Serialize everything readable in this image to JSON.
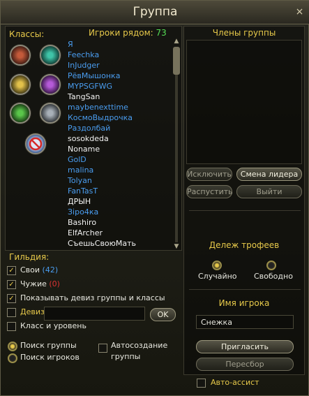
{
  "window": {
    "title": "Группа",
    "close": "×"
  },
  "classes": {
    "label": "Классы:"
  },
  "nearby": {
    "label": "Игроки рядом:",
    "count": "73"
  },
  "players": [
    {
      "name": "Я",
      "color": "#4a9df0"
    },
    {
      "name": "Feechka",
      "color": "#4a9df0"
    },
    {
      "name": "InJudger",
      "color": "#4a9df0"
    },
    {
      "name": "РёвМышонка",
      "color": "#4a9df0"
    },
    {
      "name": "MYPSGFWG",
      "color": "#4a9df0"
    },
    {
      "name": "TangSan",
      "color": "#f2f2f2"
    },
    {
      "name": "maybenexttime",
      "color": "#4a9df0"
    },
    {
      "name": "КосмоВыдрочка",
      "color": "#4a9df0"
    },
    {
      "name": "Раздолбай",
      "color": "#4a9df0"
    },
    {
      "name": "sosokdeda",
      "color": "#f2f2f2"
    },
    {
      "name": "Noname",
      "color": "#f2f2f2"
    },
    {
      "name": "GolD",
      "color": "#4a9df0"
    },
    {
      "name": "malina",
      "color": "#4a9df0"
    },
    {
      "name": "Tolyan",
      "color": "#4a9df0"
    },
    {
      "name": "FanTasT",
      "color": "#4a9df0"
    },
    {
      "name": "ДРЫН",
      "color": "#f2f2f2"
    },
    {
      "name": "Зіро4ка",
      "color": "#4a9df0"
    },
    {
      "name": "Bashiro",
      "color": "#f2f2f2"
    },
    {
      "name": "ElfArcher",
      "color": "#f2f2f2"
    },
    {
      "name": "СъешьСвоюМать",
      "color": "#f2f2f2"
    }
  ],
  "guild": {
    "label": "Гильдия:",
    "own_label": "Свои",
    "own_count": "(42)",
    "foreign_label": "Чужие",
    "foreign_count": "(0)",
    "show_motto": "Показывать девиз группы и классы",
    "motto_label": "Девиз",
    "motto_value": "",
    "ok": "OK",
    "class_level": "Класс и уровень"
  },
  "search": {
    "group": "Поиск группы",
    "players": "Поиск игроков",
    "autocreate_line1": "Автосоздание",
    "autocreate_line2": "группы"
  },
  "members": {
    "label": "Члены группы"
  },
  "actions": {
    "exclude": "Исключить",
    "leader": "Смена лидера",
    "disband": "Распустить",
    "leave": "Выйти"
  },
  "loot": {
    "label": "Дележ трофеев",
    "random": "Случайно",
    "free": "Свободно"
  },
  "invite": {
    "label": "Имя игрока",
    "name_value": "Снежка",
    "invite_btn": "Пригласить",
    "reselect_btn": "Пересбор",
    "auto_assist": "Авто-ассист"
  },
  "colors": {
    "accent_gold": "#e7c94a",
    "player_blue": "#4a9df0",
    "count_green": "#55dd55",
    "count_red": "#dd3333"
  }
}
